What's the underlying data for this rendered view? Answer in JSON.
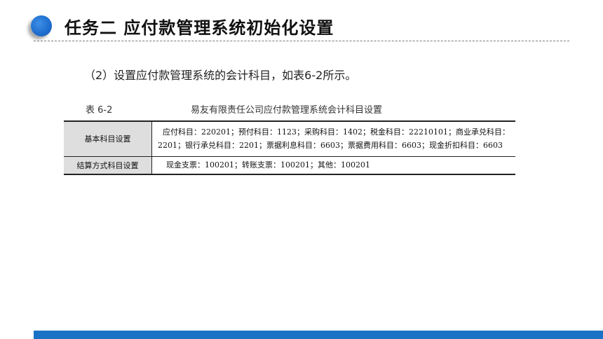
{
  "header": {
    "title": "任务二  应付款管理系统初始化设置"
  },
  "content": {
    "paragraph": "（2）设置应付款管理系统的会计科目，如表6-2所示。",
    "table_number": "表 6-2",
    "table_title": "易友有限责任公司应付款管理系统会计科目设置",
    "rows": [
      {
        "label": "基本科目设置",
        "value_line1": "应付科目：220201；预付科目：1123；采购科目：1402；税金科目：22210101；商业承兑科目：",
        "value_line2": "2201；银行承兑科目：2201；票据利息科目：6603；票据费用科目：6603；现金折扣科目：6603"
      },
      {
        "label": "结算方式科目设置",
        "value_line1": "现金支票：100201；转账支票：100201；其他：100201"
      }
    ]
  },
  "colors": {
    "accent": "#1a72c4",
    "label_cell_bg": "#dedede"
  }
}
